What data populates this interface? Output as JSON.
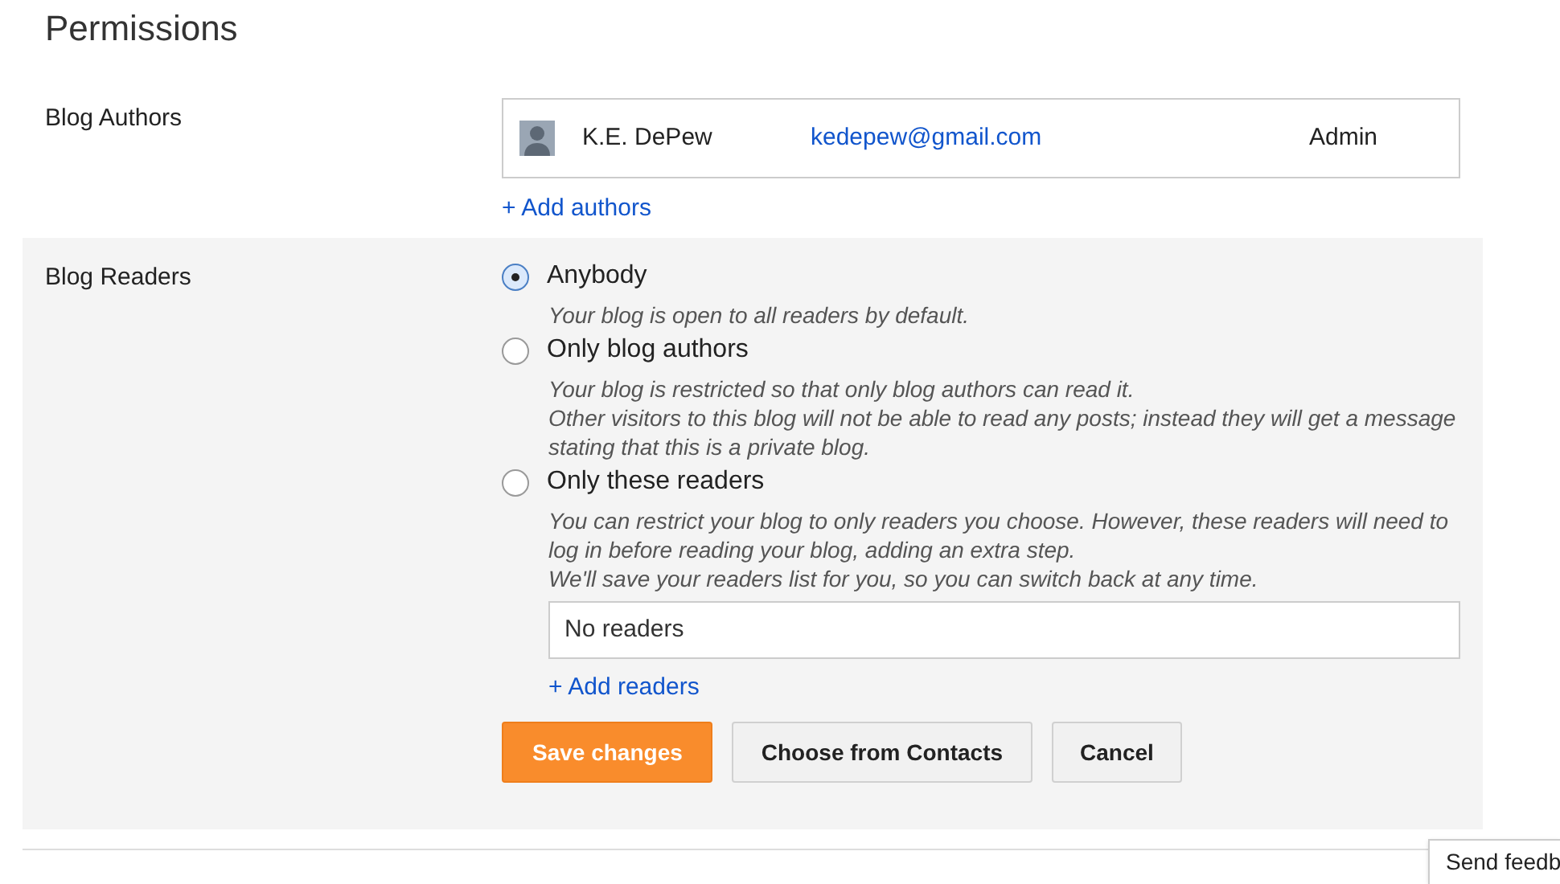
{
  "title": "Permissions",
  "blog_authors": {
    "label": "Blog Authors",
    "authors": [
      {
        "name": "K.E. DePew",
        "email": "kedepew@gmail.com",
        "role": "Admin"
      }
    ],
    "add_link": "+ Add authors"
  },
  "blog_readers": {
    "label": "Blog Readers",
    "options": [
      {
        "label": "Anybody",
        "selected": true,
        "description": [
          "Your blog is open to all readers by default."
        ]
      },
      {
        "label": "Only blog authors",
        "selected": false,
        "description": [
          "Your blog is restricted so that only blog authors can read it.",
          "Other visitors to this blog will not be able to read any posts; instead they will get a message stating that this is a private blog."
        ]
      },
      {
        "label": "Only these readers",
        "selected": false,
        "description": [
          "You can restrict your blog to only readers you choose. However, these readers will need to log in before reading your blog, adding an extra step.",
          "We'll save your readers list for you, so you can switch back at any time."
        ]
      }
    ],
    "readers_field": {
      "value": "No readers"
    },
    "add_link": "+ Add readers",
    "buttons": [
      {
        "label": "Save changes",
        "kind": "primary"
      },
      {
        "label": "Choose from Contacts",
        "kind": "secondary"
      },
      {
        "label": "Cancel",
        "kind": "secondary"
      }
    ]
  },
  "feedback_button": "Send feedb"
}
